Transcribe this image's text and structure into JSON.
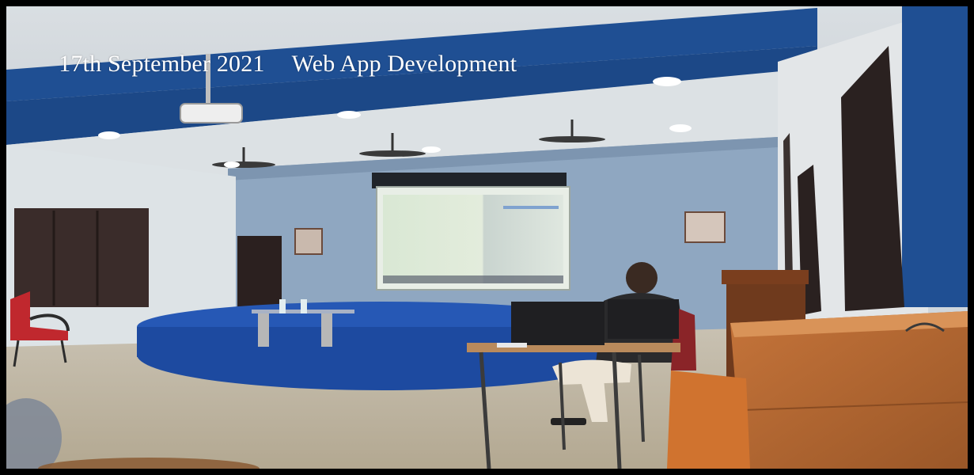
{
  "caption": {
    "date": "17th September 2021",
    "title": "Web App Development"
  }
}
